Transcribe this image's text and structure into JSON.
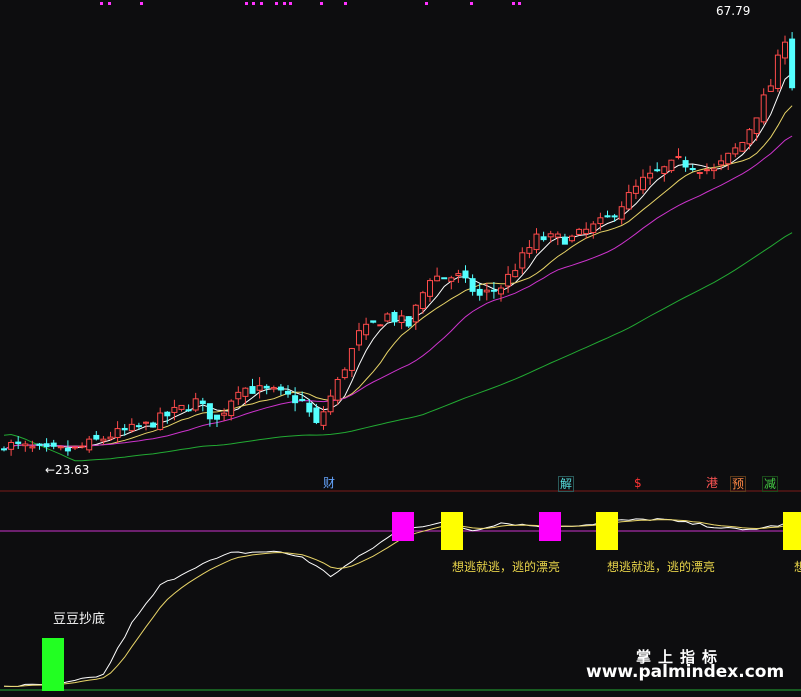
{
  "chart_data": [
    {
      "type": "candlestick",
      "panel": "price",
      "ylim": [
        20,
        70
      ],
      "annotations": {
        "high_label": "67.79",
        "low_label": "←23.63"
      },
      "candles_count": 112,
      "start_close": 24.6,
      "end_close": 62.0,
      "series": [
        {
          "name": "",
          "color": "#ffffff",
          "period": 5
        },
        {
          "name": "",
          "color": "#e8d468",
          "period": 10
        },
        {
          "name": "",
          "color": "#cc33cc",
          "period": 20
        },
        {
          "name": "",
          "color": "#22aa33",
          "period": 60
        }
      ],
      "event_tags": [
        {
          "text": "财",
          "color": "#66a6ff"
        },
        {
          "text": "解",
          "color": "#55dddd"
        },
        {
          "text": "$",
          "color": "#ff3333"
        },
        {
          "text": "港",
          "color": "#ff5555"
        },
        {
          "text": "预",
          "color": "#ff8844"
        },
        {
          "text": "减",
          "color": "#44cc44"
        }
      ],
      "colors": {
        "up": "#ff4b4b",
        "down": "#54ffff"
      }
    },
    {
      "type": "line",
      "panel": "indicator",
      "ylim": [
        0,
        100
      ],
      "series": [
        {
          "name": "",
          "color": "#ffffff"
        },
        {
          "name": "",
          "color": "#e8d468"
        }
      ],
      "reference_line_level": 90,
      "signals": [
        {
          "kind": "bottom",
          "color": "#22ff22",
          "label": "豆豆抄底"
        },
        {
          "kind": "top",
          "color": "#ff00ff",
          "label": ""
        },
        {
          "kind": "top",
          "color": "#ffff00",
          "label": "想逃就逃，逃的漂亮"
        },
        {
          "kind": "top",
          "color": "#ff00ff",
          "label": ""
        },
        {
          "kind": "top",
          "color": "#ffff00",
          "label": "想逃就逃，逃的漂亮"
        },
        {
          "kind": "top",
          "color": "#ffff00",
          "label": "想"
        }
      ]
    }
  ],
  "watermark": {
    "line1": "掌上指标",
    "line2": "www.palmindex.com"
  }
}
